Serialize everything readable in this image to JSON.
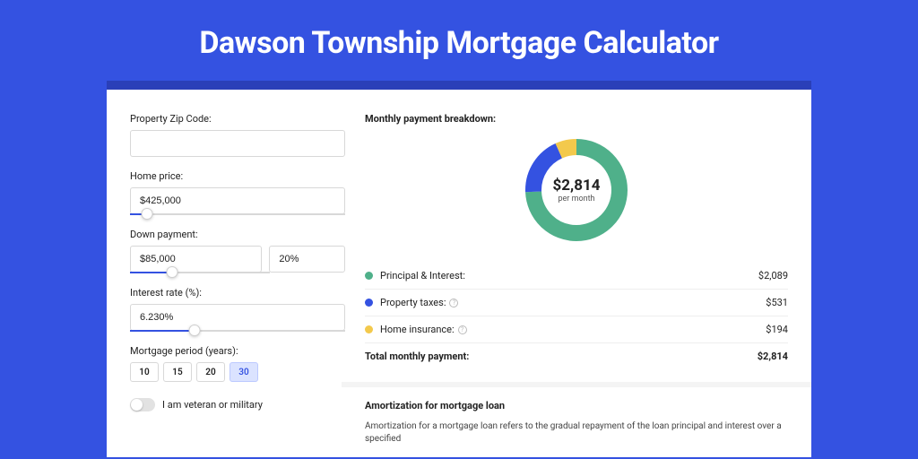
{
  "page_title": "Dawson Township Mortgage Calculator",
  "form": {
    "zip_label": "Property Zip Code:",
    "zip_value": "",
    "home_price_label": "Home price:",
    "home_price_value": "$425,000",
    "home_price_slider_pct": 8,
    "down_payment_label": "Down payment:",
    "down_payment_value": "$85,000",
    "down_payment_pct_value": "20%",
    "down_payment_slider_pct": 20,
    "interest_label": "Interest rate (%):",
    "interest_value": "6.230%",
    "interest_slider_pct": 30,
    "period_label": "Mortgage period (years):",
    "periods": [
      "10",
      "15",
      "20",
      "30"
    ],
    "period_selected": "30",
    "veteran_label": "I am veteran or military"
  },
  "breakdown": {
    "title": "Monthly payment breakdown:",
    "center_amount": "$2,814",
    "center_sub": "per month",
    "rows": [
      {
        "label": "Principal & Interest:",
        "value": "$2,089",
        "color": "#4fb08a",
        "info": false
      },
      {
        "label": "Property taxes:",
        "value": "$531",
        "color": "#3452e1",
        "info": true
      },
      {
        "label": "Home insurance:",
        "value": "$194",
        "color": "#f3c94c",
        "info": true
      }
    ],
    "total_label": "Total monthly payment:",
    "total_value": "$2,814"
  },
  "amort": {
    "title": "Amortization for mortgage loan",
    "text": "Amortization for a mortgage loan refers to the gradual repayment of the loan principal and interest over a specified"
  },
  "chart_data": {
    "type": "pie",
    "title": "Monthly payment breakdown",
    "series": [
      {
        "name": "Principal & Interest",
        "value": 2089,
        "color": "#4fb08a"
      },
      {
        "name": "Property taxes",
        "value": 531,
        "color": "#3452e1"
      },
      {
        "name": "Home insurance",
        "value": 194,
        "color": "#f3c94c"
      }
    ],
    "total": 2814
  }
}
